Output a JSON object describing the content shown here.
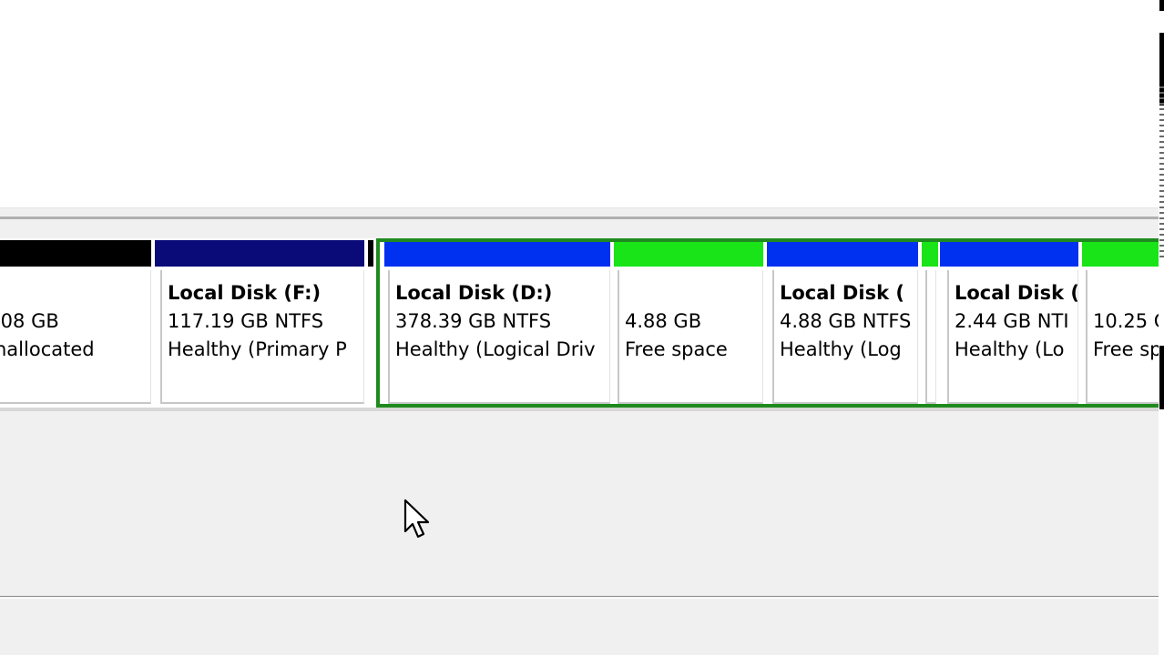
{
  "colors": {
    "unallocated": "#000000",
    "primary": "#0a0a78",
    "logical": "#0030f0",
    "free_space": "#18e418",
    "selection": "#1e8a1e"
  },
  "partitions": [
    {
      "name": "",
      "size": ".08 GB",
      "status": "nallocated",
      "bar": "unallocated"
    },
    {
      "name": "Local Disk  (F:)",
      "size": "117.19 GB NTFS",
      "status": "Healthy (Primary P",
      "bar": "primary"
    },
    {
      "name": "Local Disk  (D:)",
      "size": "378.39 GB NTFS",
      "status": "Healthy (Logical Driv",
      "bar": "logical"
    },
    {
      "name": "",
      "size": "4.88 GB",
      "status": "Free space",
      "bar": "free_space"
    },
    {
      "name": "Local Disk  (",
      "size": "4.88 GB NTFS",
      "status": "Healthy (Log",
      "bar": "logical"
    },
    {
      "name": "",
      "size": "",
      "status": "",
      "bar": "free_space"
    },
    {
      "name": "Local Disk (",
      "size": "2.44 GB NTI",
      "status": "Healthy (Lo",
      "bar": "logical"
    },
    {
      "name": "",
      "size": "10.25 G",
      "status": "Free sp",
      "bar": "free_space"
    }
  ],
  "cursor": {
    "icon": "arrow-pointer-icon"
  }
}
